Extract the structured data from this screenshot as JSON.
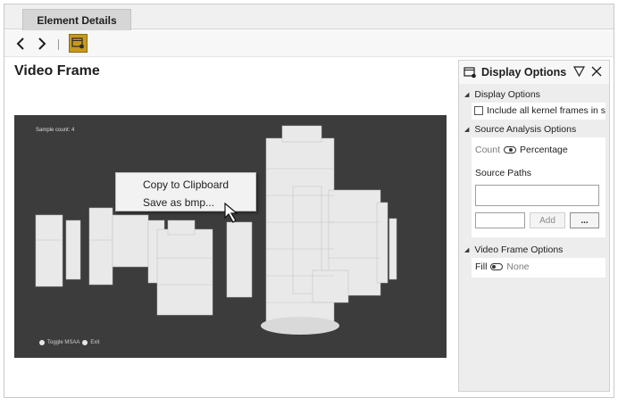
{
  "tabs": [
    {
      "label": "Element Details"
    }
  ],
  "toolbar": {
    "back_icon": "chevron-left-icon",
    "forward_icon": "chevron-right-icon",
    "frame_icon": "video-frame-icon"
  },
  "main": {
    "title": "Video Frame",
    "video": {
      "sample_text": "Sample count: 4",
      "overlay_hint_1": "Toggle MSAA",
      "overlay_hint_2": "Exit"
    },
    "context_menu": {
      "items": [
        {
          "label": "Copy to Clipboard"
        },
        {
          "label": "Save as bmp..."
        }
      ]
    }
  },
  "panel": {
    "title": "Display Options",
    "sections": {
      "display": {
        "header": "Display Options",
        "include_kernel": "Include all kernel frames in st"
      },
      "source": {
        "header": "Source Analysis Options",
        "count_label": "Count",
        "percentage_label": "Percentage",
        "paths_label": "Source Paths",
        "add_label": "Add",
        "more_label": "..."
      },
      "video": {
        "header": "Video Frame Options",
        "fill_label": "Fill",
        "none_label": "None"
      }
    }
  },
  "colors": {
    "frame_button": "#c79a1e",
    "video_background": "#3c3c3c",
    "panel_background": "#ededed"
  }
}
